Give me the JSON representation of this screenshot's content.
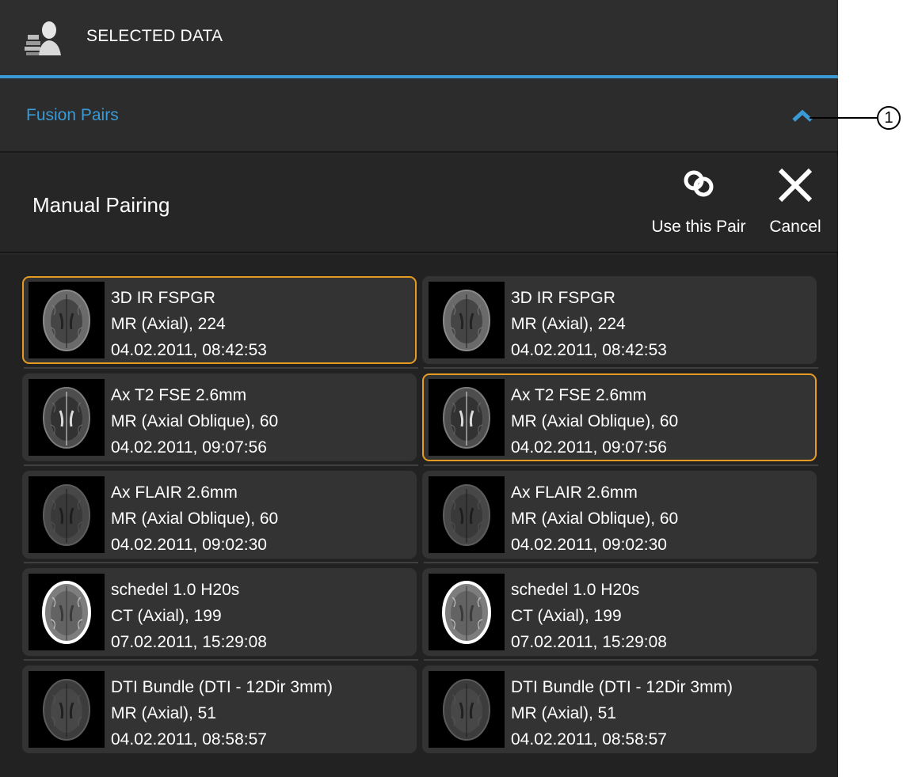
{
  "header": {
    "title": "SELECTED DATA",
    "icon": "patient-data-icon"
  },
  "accordion": {
    "title": "Fusion Pairs",
    "state": "expanded",
    "icon": "chevron-up-icon"
  },
  "toolbar": {
    "title": "Manual Pairing",
    "use_pair_label": "Use this Pair",
    "use_pair_icon": "link-icon",
    "cancel_label": "Cancel",
    "cancel_icon": "close-icon"
  },
  "callout": {
    "label": "1"
  },
  "colors": {
    "accent": "#3a9ad6",
    "selection": "#e59a22",
    "panel": "#272727"
  },
  "series_left": [
    {
      "name": "3D IR FSPGR",
      "detail": "MR (Axial), 224",
      "date": "04.02.2011, 08:42:53",
      "selected": true,
      "thumb": "t1"
    },
    {
      "name": "Ax T2 FSE 2.6mm",
      "detail": "MR (Axial Oblique), 60",
      "date": "04.02.2011, 09:07:56",
      "selected": false,
      "thumb": "t2"
    },
    {
      "name": "Ax FLAIR 2.6mm",
      "detail": "MR (Axial Oblique), 60",
      "date": "04.02.2011, 09:02:30",
      "selected": false,
      "thumb": "flair"
    },
    {
      "name": "schedel 1.0 H20s",
      "detail": "CT (Axial), 199",
      "date": "07.02.2011, 15:29:08",
      "selected": false,
      "thumb": "ct"
    },
    {
      "name": "DTI Bundle (DTI - 12Dir 3mm)",
      "detail": "MR (Axial), 51",
      "date": "04.02.2011, 08:58:57",
      "selected": false,
      "thumb": "dti"
    }
  ],
  "series_right": [
    {
      "name": "3D IR FSPGR",
      "detail": "MR (Axial), 224",
      "date": "04.02.2011, 08:42:53",
      "selected": false,
      "thumb": "t1"
    },
    {
      "name": "Ax T2 FSE 2.6mm",
      "detail": "MR (Axial Oblique), 60",
      "date": "04.02.2011, 09:07:56",
      "selected": true,
      "thumb": "t2"
    },
    {
      "name": "Ax FLAIR 2.6mm",
      "detail": "MR (Axial Oblique), 60",
      "date": "04.02.2011, 09:02:30",
      "selected": false,
      "thumb": "flair"
    },
    {
      "name": "schedel 1.0 H20s",
      "detail": "CT (Axial), 199",
      "date": "07.02.2011, 15:29:08",
      "selected": false,
      "thumb": "ct"
    },
    {
      "name": "DTI Bundle (DTI - 12Dir 3mm)",
      "detail": "MR (Axial), 51",
      "date": "04.02.2011, 08:58:57",
      "selected": false,
      "thumb": "dti"
    }
  ]
}
